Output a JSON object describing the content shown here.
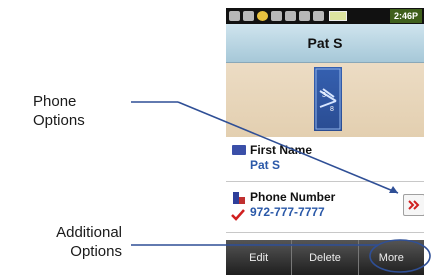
{
  "callouts": {
    "phone_options": "Phone Options",
    "additional_line1": "Additional",
    "additional_line2": "Options"
  },
  "status_bar": {
    "icons": [
      "signal-icon",
      "message-icon",
      "alarm-icon",
      "keypad-icon",
      "voicemail-icon",
      "mute-icon",
      "speaker-icon",
      "battery-icon"
    ],
    "time": "2:46P"
  },
  "contact": {
    "title": "Pat S",
    "fields": {
      "first_name_label": "First Name",
      "first_name_value": "Pat S",
      "phone_label": "Phone Number",
      "phone_value": "972-777-7777"
    }
  },
  "softkeys": {
    "edit": "Edit",
    "delete": "Delete",
    "more": "More"
  },
  "colors": {
    "title_bar": "#b7d6e4",
    "photo_band": "#e8d5b8",
    "value_text": "#2a58a8",
    "leader_line": "#2f4f96",
    "options_arrow": "#d02020",
    "softkey_bar": "#333333"
  }
}
